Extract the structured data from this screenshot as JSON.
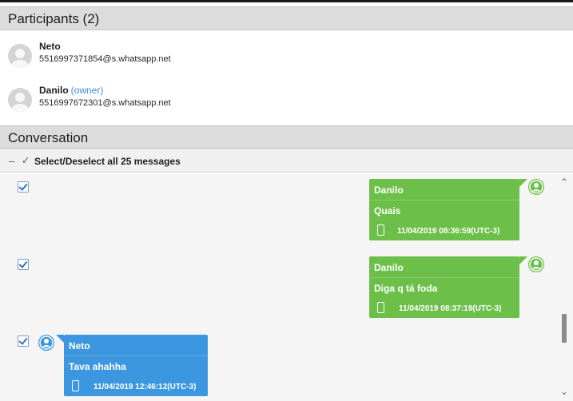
{
  "participants_section": {
    "title": "Participants (2)",
    "items": [
      {
        "name": "Neto",
        "owner_tag": "",
        "jid": "5516997371854@s.whatsapp.net"
      },
      {
        "name": "Danilo",
        "owner_tag": "(owner)",
        "jid": "5516997672301@s.whatsapp.net"
      }
    ]
  },
  "conversation_section": {
    "title": "Conversation",
    "select_all": {
      "dash": "–",
      "check": "✓",
      "label": "Select/Deselect all 25 messages"
    },
    "messages": [
      {
        "direction": "out",
        "sender": "Danilo",
        "text": "Quais",
        "time": "11/04/2019 08:36:59(UTC-3)",
        "checked": true
      },
      {
        "direction": "out",
        "sender": "Danilo",
        "text": "Diga q tá foda",
        "time": "11/04/2019 08:37:19(UTC-3)",
        "checked": true
      },
      {
        "direction": "in",
        "sender": "Neto",
        "text": "Tava ahahha",
        "time": "11/04/2019 12:46:12(UTC-3)",
        "checked": true
      }
    ]
  },
  "scrollbar": {
    "up_arrow": "⌃",
    "down_arrow": "⌄"
  },
  "colors": {
    "outgoing_bubble": "#6cc04a",
    "incoming_bubble": "#3d97e0",
    "section_header": "#dcdcdc",
    "owner_link": "#3a8fd8"
  },
  "icons": {
    "participant_avatar": "user-silhouette-icon",
    "bubble_avatar": "user-circle-icon",
    "device": "phone-icon",
    "checkbox": "checkbox-checked-icon"
  }
}
